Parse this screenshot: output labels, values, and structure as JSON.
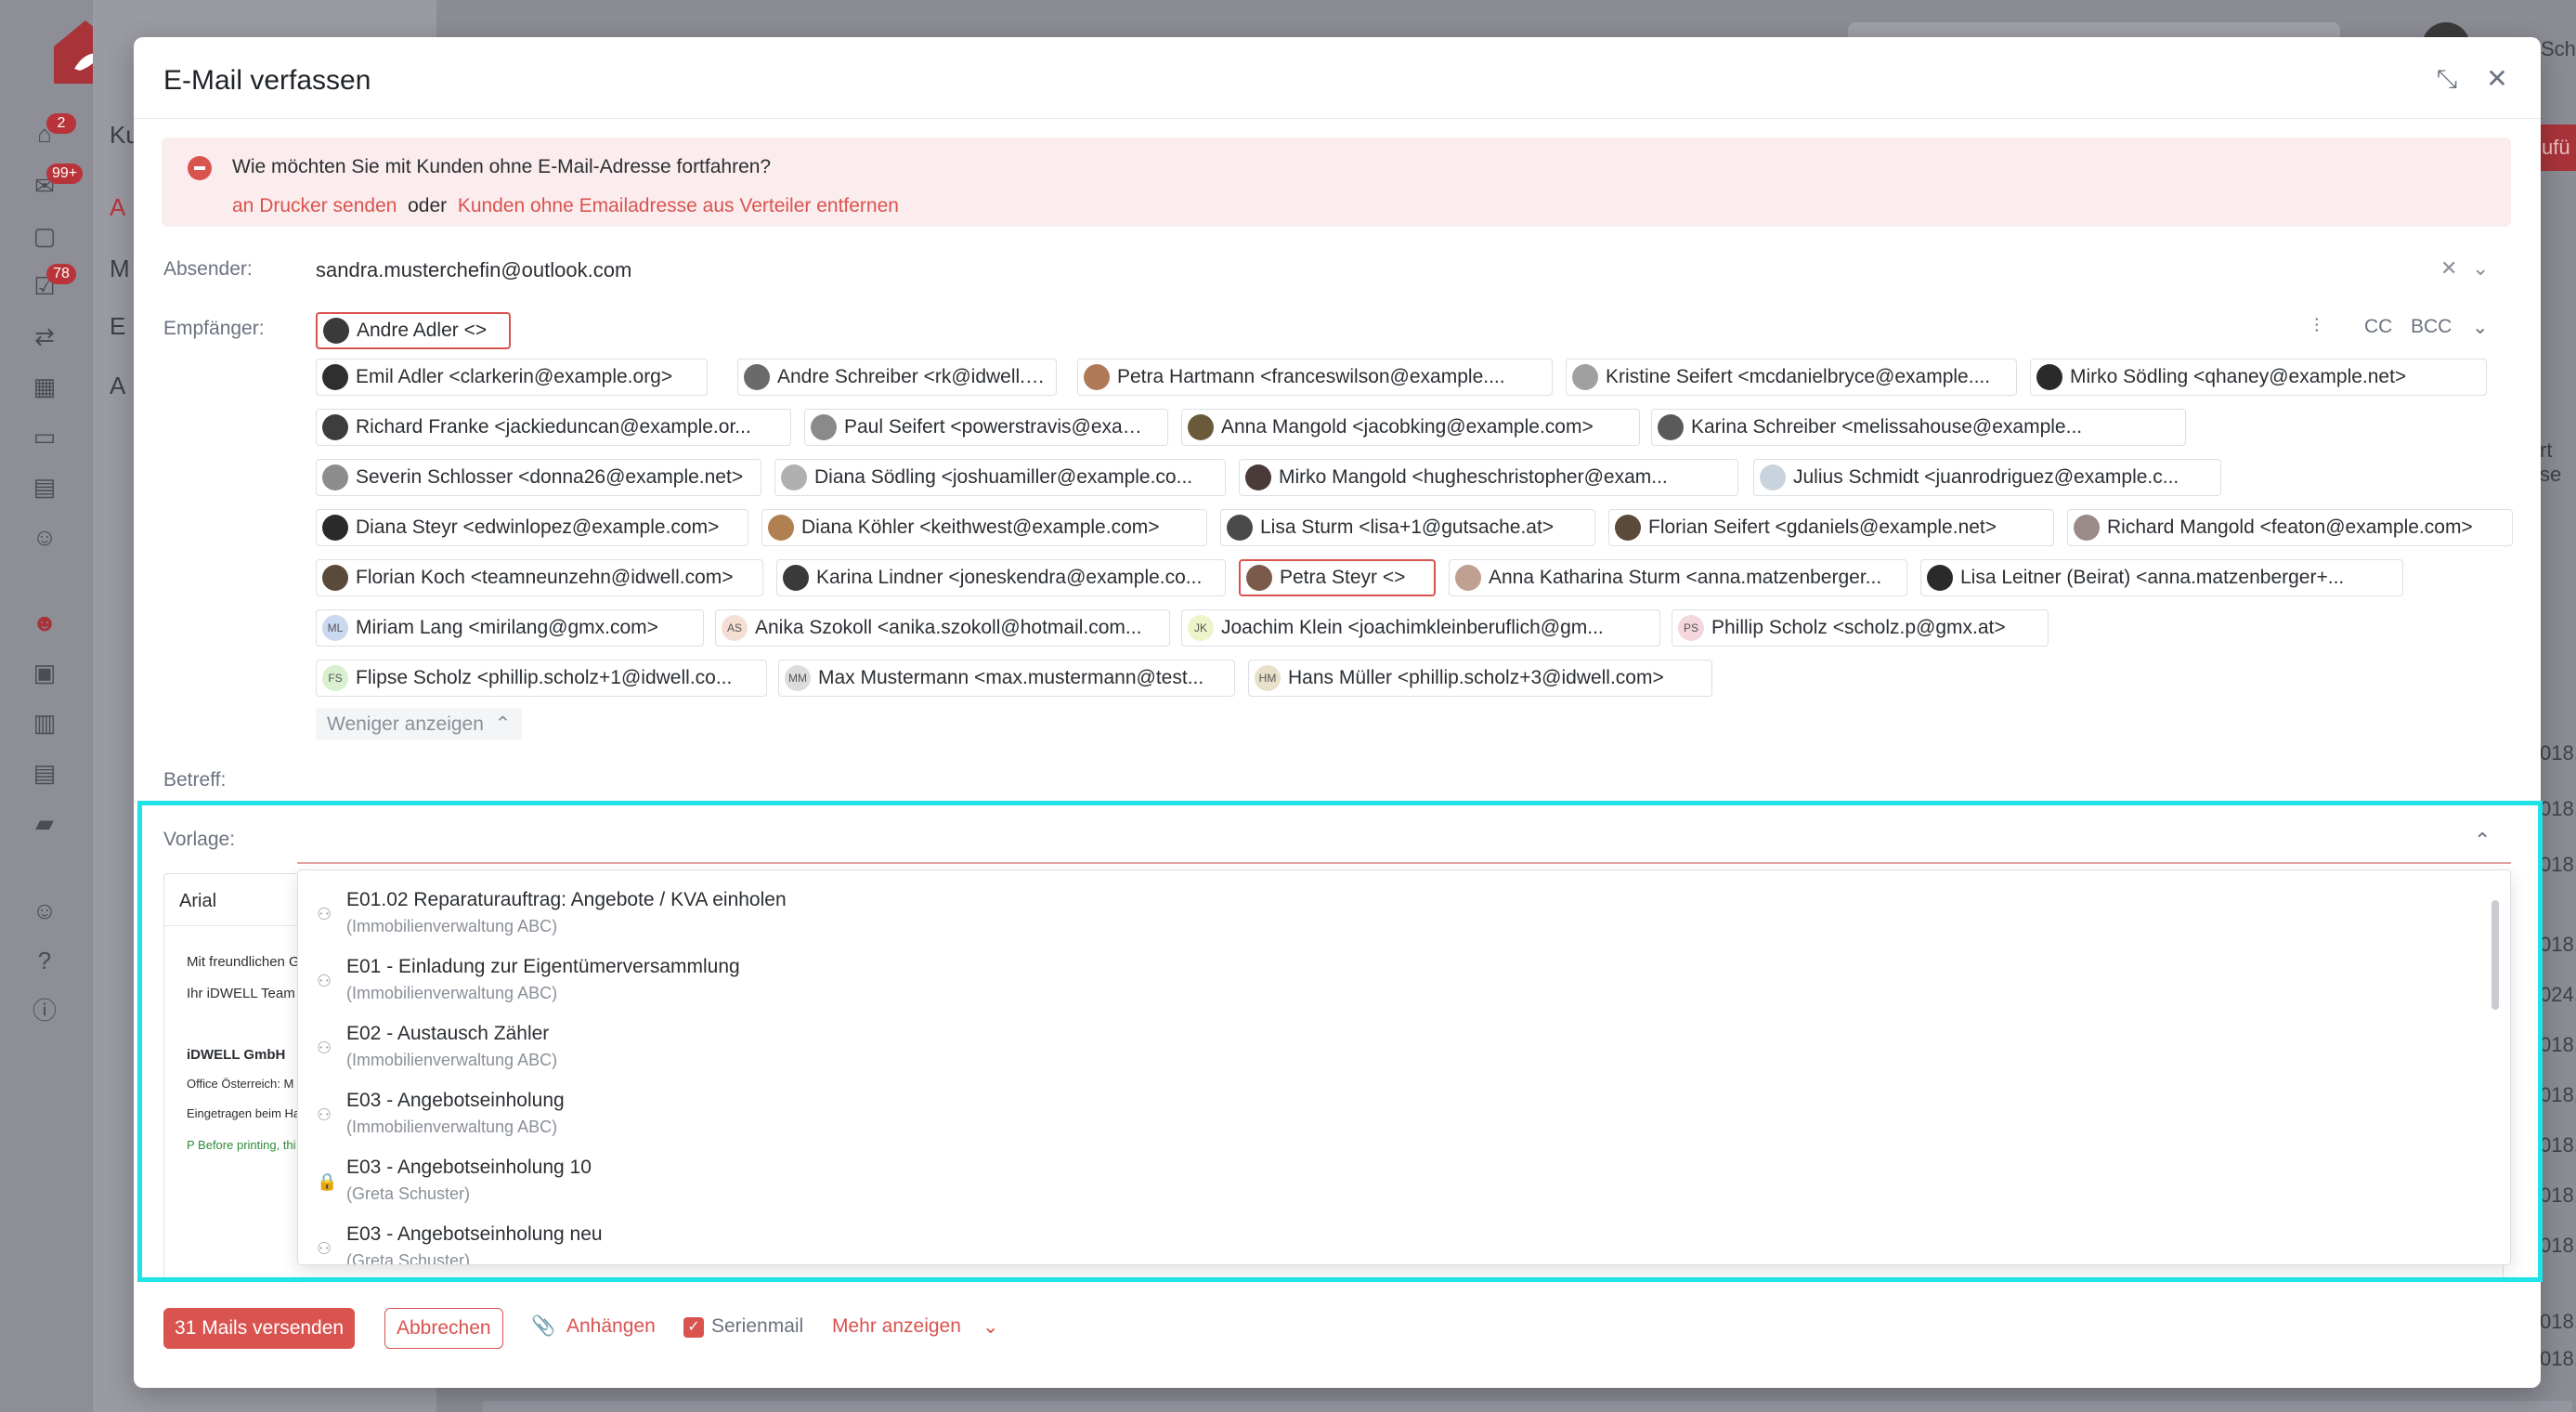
{
  "background": {
    "nav_badges": [
      "2",
      "99+",
      "78"
    ],
    "subnav_letters": [
      "Ku",
      "A",
      "M",
      "E",
      "A"
    ],
    "topbar_user_text": "Schu",
    "red_button_text": "zufü",
    "right_dates": [
      "018,",
      "018,",
      "018,",
      "018,",
      "024,",
      "018,",
      "018,",
      "018,",
      "018,",
      "018,",
      "018,",
      "018,"
    ],
    "right_side_text": "rt se"
  },
  "modal": {
    "title": "E-Mail verfassen"
  },
  "alert": {
    "question": "Wie möchten Sie mit Kunden ohne E-Mail-Adresse fortfahren?",
    "link_print": "an Drucker senden",
    "or": "oder",
    "link_remove": "Kunden ohne Emailadresse aus Verteiler entfernen"
  },
  "sender": {
    "label": "Absender:",
    "value": "sandra.musterchefin@outlook.com"
  },
  "recipients": {
    "label": "Empfänger:",
    "cc": "CC",
    "bcc": "BCC",
    "show_less": "Weniger anzeigen",
    "chips": [
      {
        "text": "Andre Adler <>",
        "initials": ""
      },
      {
        "text": "Emil Adler <clarkerin@example.org>",
        "initials": ""
      },
      {
        "text": "Andre Schreiber <rk@idwell.at>",
        "initials": ""
      },
      {
        "text": "Petra Hartmann <franceswilson@example....",
        "initials": ""
      },
      {
        "text": "Kristine Seifert <mcdanielbryce@example....",
        "initials": ""
      },
      {
        "text": "Mirko Södling <qhaney@example.net>",
        "initials": ""
      },
      {
        "text": "Richard Franke <jackieduncan@example.or...",
        "initials": ""
      },
      {
        "text": "Paul Seifert <powerstravis@example.net>",
        "initials": ""
      },
      {
        "text": "Anna Mangold <jacobking@example.com>",
        "initials": ""
      },
      {
        "text": "Karina Schreiber <melissahouse@example...",
        "initials": ""
      },
      {
        "text": "Severin Schlosser <donna26@example.net>",
        "initials": ""
      },
      {
        "text": "Diana Södling <joshuamiller@example.co...",
        "initials": ""
      },
      {
        "text": "Mirko Mangold <hugheschristopher@exam...",
        "initials": ""
      },
      {
        "text": "Julius Schmidt <juanrodriguez@example.c...",
        "initials": ""
      },
      {
        "text": "Diana Steyr <edwinlopez@example.com>",
        "initials": ""
      },
      {
        "text": "Diana Köhler <keithwest@example.com>",
        "initials": ""
      },
      {
        "text": "Lisa Sturm <lisa+1@gutsache.at>",
        "initials": ""
      },
      {
        "text": "Florian Seifert <gdaniels@example.net>",
        "initials": ""
      },
      {
        "text": "Richard Mangold <featon@example.com>",
        "initials": ""
      },
      {
        "text": "Florian Koch <teamneunzehn@idwell.com>",
        "initials": ""
      },
      {
        "text": "Karina Lindner <joneskendra@example.co...",
        "initials": ""
      },
      {
        "text": "Petra Steyr <>",
        "initials": ""
      },
      {
        "text": "Anna Katharina Sturm <anna.matzenberger...",
        "initials": ""
      },
      {
        "text": "Lisa Leitner (Beirat) <anna.matzenberger+...",
        "initials": ""
      },
      {
        "text": "Miriam Lang <mirilang@gmx.com>",
        "initials": "ML"
      },
      {
        "text": "Anika Szokoll <anika.szokoll@hotmail.com...",
        "initials": "AS"
      },
      {
        "text": "Joachim Klein <joachimkleinberuflich@gm...",
        "initials": "JK"
      },
      {
        "text": "Phillip Scholz <scholz.p@gmx.at>",
        "initials": "PS"
      },
      {
        "text": "Flipse Scholz <phillip.scholz+1@idwell.co...",
        "initials": "FS"
      },
      {
        "text": "Max Mustermann <max.mustermann@test...",
        "initials": "MM"
      },
      {
        "text": "Hans Müller <phillip.scholz+3@idwell.com>",
        "initials": "HM"
      }
    ]
  },
  "subject": {
    "label": "Betreff:"
  },
  "template": {
    "label": "Vorlage:",
    "options": [
      {
        "title": "E01.02 Reparaturauftrag: Angebote / KVA einholen",
        "owner": "(Immobilienverwaltung ABC)",
        "icon": "group-icon"
      },
      {
        "title": "E01 - Einladung zur Eigentümerversammlung",
        "owner": "(Immobilienverwaltung ABC)",
        "icon": "group-icon"
      },
      {
        "title": "E02 - Austausch Zähler",
        "owner": "(Immobilienverwaltung ABC)",
        "icon": "group-icon"
      },
      {
        "title": "E03 - Angebotseinholung",
        "owner": "(Immobilienverwaltung ABC)",
        "icon": "group-icon"
      },
      {
        "title": "E03 - Angebotseinholung 10",
        "owner": "(Greta Schuster)",
        "icon": "lock-icon"
      },
      {
        "title": "E03 - Angebotseinholung neu",
        "owner": "(Greta Schuster)",
        "icon": "group-icon"
      }
    ]
  },
  "editor": {
    "font": "Arial",
    "signature": [
      "Mit freundlichen G",
      "Ihr iDWELL Team",
      "iDWELL GmbH",
      "Office Österreich: M",
      "Eingetragen beim Ha",
      "P Before printing, thi"
    ]
  },
  "footer": {
    "send": "31 Mails versenden",
    "cancel": "Abbrechen",
    "attach": "Anhängen",
    "serial": "Serienmail",
    "more": "Mehr anzeigen"
  },
  "colors": {
    "accent": "#d9534f",
    "highlight": "#20e3e8",
    "alert_bg": "#fbeced"
  }
}
